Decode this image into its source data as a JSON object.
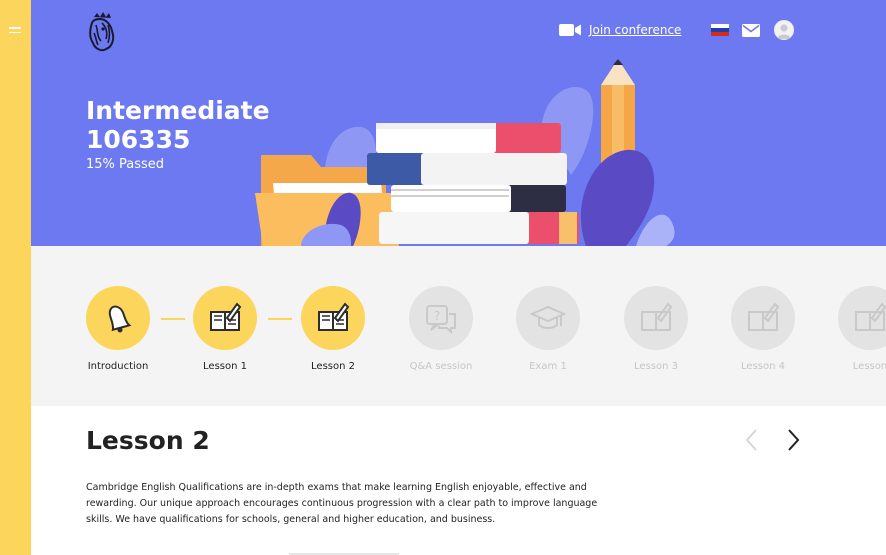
{
  "header": {
    "join_label": "Join conference",
    "icons": [
      "camera-icon",
      "russian-flag-icon",
      "mail-icon",
      "user-avatar-icon"
    ]
  },
  "hero": {
    "title_line1": "Intermediate",
    "title_line2": "106335",
    "progress_text": "15% Passed",
    "progress_percent": 15
  },
  "steps": [
    {
      "label": "Introduction",
      "icon": "bell-icon",
      "state": "done"
    },
    {
      "label": "Lesson 1",
      "icon": "book-icon",
      "state": "done"
    },
    {
      "label": "Lesson 2",
      "icon": "book-icon",
      "state": "current"
    },
    {
      "label": "Q&A session",
      "icon": "chat-bubbles-icon",
      "state": "locked"
    },
    {
      "label": "Exam 1",
      "icon": "graduation-cap-icon",
      "state": "locked"
    },
    {
      "label": "Lesson 3",
      "icon": "book-icon",
      "state": "locked"
    },
    {
      "label": "Lesson 4",
      "icon": "book-icon",
      "state": "locked"
    },
    {
      "label": "Lesson",
      "icon": "book-icon",
      "state": "locked"
    }
  ],
  "lesson": {
    "title": "Lesson 2",
    "description": "Cambridge English Qualifications are in-depth exams that make learning English enjoyable, effective and rewarding. Our unique approach encourages continuous progression with a clear path to improve language skills. We have qualifications for schools, general and higher education, and business."
  },
  "colors": {
    "accent": "#fcd55c",
    "hero_bg": "#6c79f0",
    "inactive": "#e3e3e3"
  }
}
